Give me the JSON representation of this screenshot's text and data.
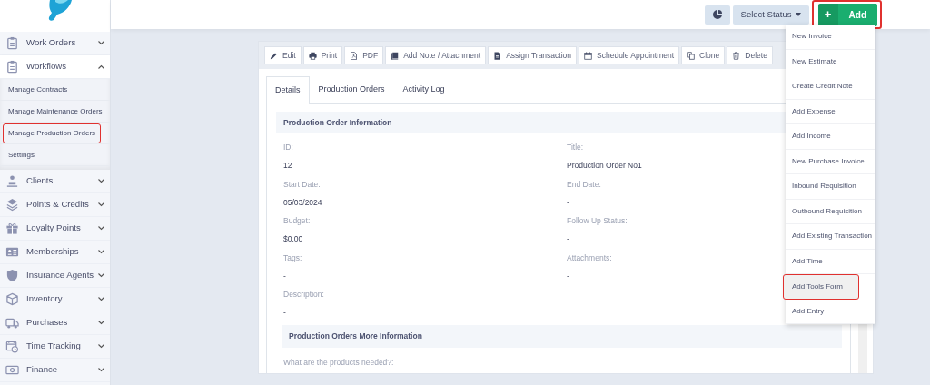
{
  "sidebar": {
    "items": [
      {
        "label": "Work Orders",
        "expanded": false
      },
      {
        "label": "Workflows",
        "expanded": true,
        "children": [
          {
            "label": "Manage Contracts",
            "highlighted": false
          },
          {
            "label": "Manage Maintenance Orders",
            "highlighted": false
          },
          {
            "label": "Manage Production Orders",
            "highlighted": true
          },
          {
            "label": "Settings",
            "highlighted": false
          }
        ]
      },
      {
        "label": "Clients",
        "expanded": false
      },
      {
        "label": "Points & Credits",
        "expanded": false
      },
      {
        "label": "Loyalty Points",
        "expanded": false
      },
      {
        "label": "Memberships",
        "expanded": false
      },
      {
        "label": "Insurance Agents",
        "expanded": false
      },
      {
        "label": "Inventory",
        "expanded": false
      },
      {
        "label": "Purchases",
        "expanded": false
      },
      {
        "label": "Time Tracking",
        "expanded": false
      },
      {
        "label": "Finance",
        "expanded": false
      }
    ]
  },
  "header": {
    "status_button": "Select Status",
    "add_button": {
      "icon_text": "+",
      "label": "Add",
      "highlighted": true
    }
  },
  "toolbar": [
    "Edit",
    "Print",
    "PDF",
    "Add Note / Attachment",
    "Assign Transaction",
    "Schedule Appointment",
    "Clone",
    "Delete"
  ],
  "tabs": [
    {
      "label": "Details",
      "selected": true
    },
    {
      "label": "Production Orders",
      "selected": false
    },
    {
      "label": "Activity Log",
      "selected": false
    }
  ],
  "section": {
    "title": "Production Order Information",
    "fields": [
      {
        "label": "ID:",
        "value": "12"
      },
      {
        "label": "Title:",
        "value": "Production Order No1"
      },
      {
        "label": "Start Date:",
        "value": "05/03/2024"
      },
      {
        "label": "End Date:",
        "value": "-"
      },
      {
        "label": "Budget:",
        "value": "$0.00"
      },
      {
        "label": "Follow Up Status:",
        "value": "-"
      },
      {
        "label": "Tags:",
        "value": "-"
      },
      {
        "label": "Attachments:",
        "value": "-"
      },
      {
        "label": "Description:",
        "value": "-"
      }
    ]
  },
  "more_section": {
    "title": "Production Orders More Information",
    "question": "What are the products needed?:"
  },
  "add_menu": [
    {
      "label": "New Invoice",
      "highlighted": false
    },
    {
      "label": "New Estimate",
      "highlighted": false
    },
    {
      "label": "Create Credit Note",
      "highlighted": false
    },
    {
      "label": "Add Expense",
      "highlighted": false
    },
    {
      "label": "Add Income",
      "highlighted": false
    },
    {
      "label": "New Purchase Invoice",
      "highlighted": false
    },
    {
      "label": "Inbound Requisition",
      "highlighted": false
    },
    {
      "label": "Outbound Requisition",
      "highlighted": false
    },
    {
      "label": "Add Existing Transaction",
      "highlighted": false
    },
    {
      "label": "Add Time",
      "highlighted": false
    },
    {
      "label": "Add Tools Form",
      "highlighted": true
    },
    {
      "label": "Add Entry",
      "highlighted": false
    }
  ]
}
